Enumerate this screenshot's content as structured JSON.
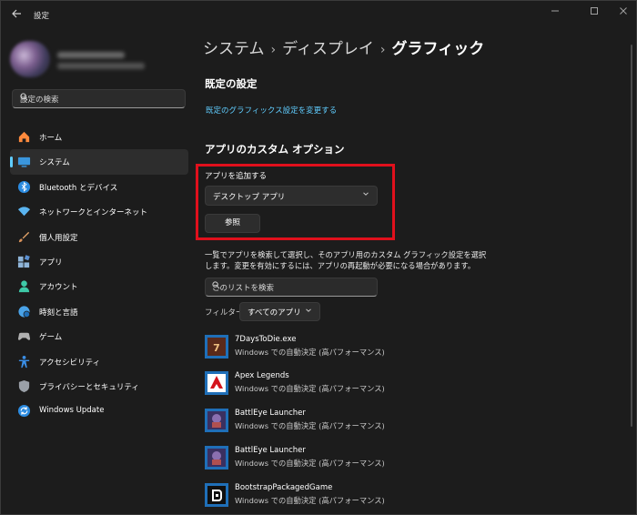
{
  "window": {
    "title": "設定",
    "back_icon": "arrow-left-icon",
    "controls": [
      "minimize-icon",
      "maximize-icon",
      "close-icon"
    ]
  },
  "sidebar": {
    "search": {
      "placeholder": "設定の検索",
      "icon": "search-icon"
    },
    "items": [
      {
        "label": "ホーム",
        "icon": "home-icon",
        "color": "#ff8a3d",
        "selected": false
      },
      {
        "label": "システム",
        "icon": "monitor-icon",
        "color": "#3a96dd",
        "selected": true
      },
      {
        "label": "Bluetooth とデバイス",
        "icon": "bluetooth-icon",
        "color": "#2b8be0",
        "selected": false
      },
      {
        "label": "ネットワークとインターネット",
        "icon": "wifi-icon",
        "color": "#5ab4f0",
        "selected": false
      },
      {
        "label": "個人用設定",
        "icon": "brush-icon",
        "color": "#e8a66a",
        "selected": false
      },
      {
        "label": "アプリ",
        "icon": "apps-icon",
        "color": "#8fb4d8",
        "selected": false
      },
      {
        "label": "アカウント",
        "icon": "person-icon",
        "color": "#3ec9a7",
        "selected": false
      },
      {
        "label": "時刻と言語",
        "icon": "globe-clock-icon",
        "color": "#4aa3e8",
        "selected": false
      },
      {
        "label": "ゲーム",
        "icon": "gamepad-icon",
        "color": "#b0b0b0",
        "selected": false
      },
      {
        "label": "アクセシビリティ",
        "icon": "accessibility-icon",
        "color": "#3a8ee6",
        "selected": false
      },
      {
        "label": "プライバシーとセキュリティ",
        "icon": "shield-icon",
        "color": "#9aa0a8",
        "selected": false
      },
      {
        "label": "Windows Update",
        "icon": "update-icon",
        "color": "#2b8be0",
        "selected": false
      }
    ]
  },
  "main": {
    "breadcrumb": [
      "システム",
      "ディスプレイ",
      "グラフィック"
    ],
    "default_section": {
      "title": "既定の設定",
      "link": "既定のグラフィックス設定を変更する"
    },
    "custom_section": {
      "title": "アプリのカスタム オプション",
      "add_label": "アプリを追加する",
      "dropdown_value": "デスクトップ アプリ",
      "browse_label": "参照",
      "description": "一覧でアプリを検索して選択し、そのアプリ用のカスタム グラフィック設定を選択します。変更を有効にするには、アプリの再起動が必要になる場合があります。",
      "list_search_placeholder": "このリストを検索",
      "filter_label": "フィルター:",
      "filter_value": "すべてのアプリ",
      "highlight_color": "#e0101c"
    },
    "apps": [
      {
        "name": "7DaysToDie.exe",
        "status": "Windows での自動決定 (高パフォーマンス)",
        "icon": "7days-app-icon"
      },
      {
        "name": "Apex Legends",
        "status": "Windows での自動決定 (高パフォーマンス)",
        "icon": "apex-app-icon"
      },
      {
        "name": "BattlEye Launcher",
        "status": "Windows での自動決定 (高パフォーマンス)",
        "icon": "battleye-app-icon"
      },
      {
        "name": "BattlEye Launcher",
        "status": "Windows での自動決定 (高パフォーマンス)",
        "icon": "battleye-app-icon"
      },
      {
        "name": "BootstrapPackagedGame",
        "status": "Windows での自動決定 (高パフォーマンス)",
        "icon": "bootstrap-app-icon"
      }
    ]
  },
  "colors": {
    "accent": "#60cdff",
    "background": "#1c1c1c",
    "panel": "#2d2d2d"
  }
}
